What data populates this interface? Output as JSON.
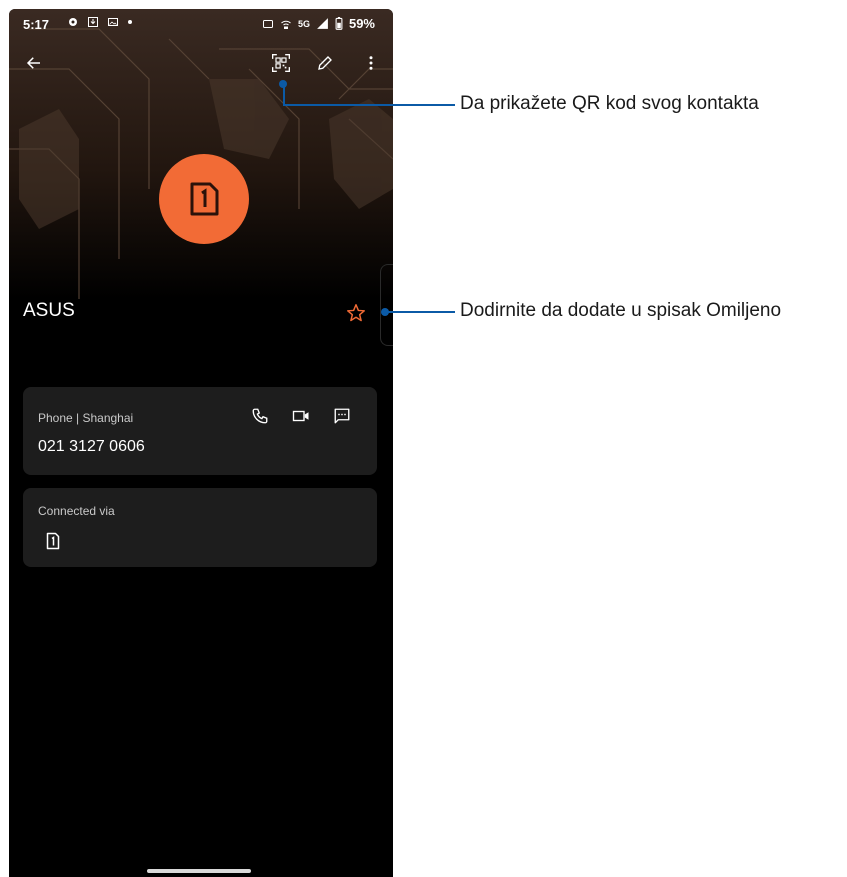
{
  "status_bar": {
    "time": "5:17",
    "battery": "59%",
    "network": "5G"
  },
  "toolbar": {
    "back_icon": "arrow-left-icon",
    "qr_icon": "qr-code-icon",
    "edit_icon": "pencil-icon",
    "more_icon": "more-vert-icon"
  },
  "contact": {
    "avatar_icon": "sim-card-1-icon",
    "avatar_color": "#f26b36",
    "name": "ASUS",
    "favorite_icon": "star-outline-icon"
  },
  "phone_card": {
    "label": "Phone | Shanghai",
    "number": "021 3127 0606",
    "actions": [
      "phone-icon",
      "video-call-icon",
      "message-icon"
    ]
  },
  "connected_card": {
    "label": "Connected via",
    "icon": "sim-card-1-icon"
  },
  "callouts": {
    "qr_text": "Da prikažete QR kod svog kontakta",
    "favorite_text": "Dodirnite da dodate u spisak Omiljeno",
    "color": "#0b5aa6"
  }
}
